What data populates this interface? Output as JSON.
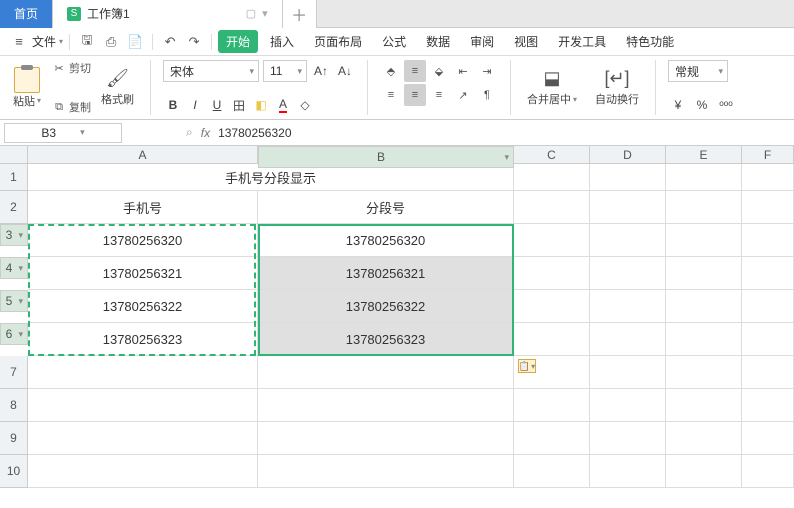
{
  "tabs": {
    "home": "首页",
    "doc": "工作簿1"
  },
  "file_label": "文件",
  "menu": [
    "开始",
    "插入",
    "页面布局",
    "公式",
    "数据",
    "审阅",
    "视图",
    "开发工具",
    "特色功能"
  ],
  "active_menu": 0,
  "clip": {
    "paste": "粘贴",
    "cut": "剪切",
    "copy": "复制",
    "fmtpaint": "格式刷"
  },
  "font": {
    "name": "宋体",
    "size": "11"
  },
  "merge": "合并居中",
  "wrap": "自动换行",
  "numfmt": "常规",
  "cellref": "B3",
  "formula": "13780256320",
  "cols": [
    "A",
    "B",
    "C",
    "D",
    "E",
    "F"
  ],
  "title": "手机号分段显示",
  "hdrA": "手机号",
  "hdrB": "分段号",
  "rows": [
    {
      "a": "13780256320",
      "b": "13780256320"
    },
    {
      "a": "13780256321",
      "b": "13780256321"
    },
    {
      "a": "13780256322",
      "b": "13780256322"
    },
    {
      "a": "13780256323",
      "b": "13780256323"
    }
  ]
}
